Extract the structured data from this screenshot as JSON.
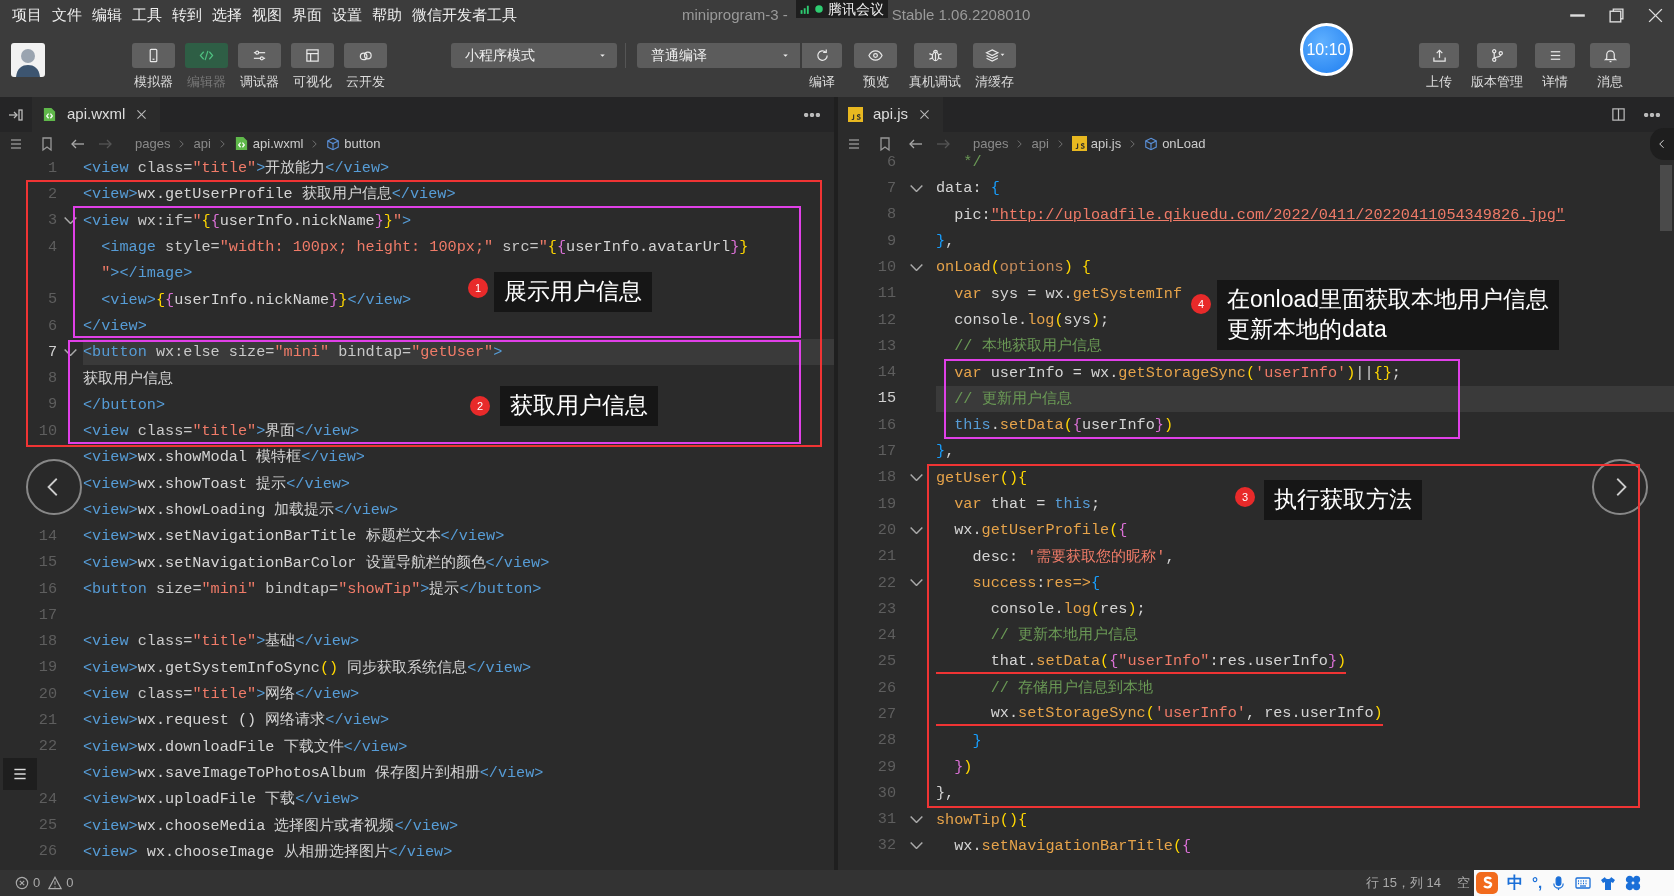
{
  "menu": [
    "项目",
    "文件",
    "编辑",
    "工具",
    "转到",
    "选择",
    "视图",
    "界面",
    "设置",
    "帮助",
    "微信开发者工具"
  ],
  "window_title": {
    "main": "miniprogram-3 -",
    "version": "Stable 1.06.2208010"
  },
  "meeting_badge": {
    "label": "腾讯会议"
  },
  "toolbar": {
    "view_buttons": [
      {
        "label": "模拟器",
        "selected": false
      },
      {
        "label": "编辑器",
        "selected": true
      },
      {
        "label": "调试器",
        "selected": false
      },
      {
        "label": "可视化",
        "selected": false
      },
      {
        "label": "云开发",
        "selected": false
      }
    ],
    "mode_select": {
      "value": "小程序模式"
    },
    "compile_select": {
      "value": "普通编译"
    },
    "actions": [
      {
        "label": "编译"
      },
      {
        "label": "预览"
      },
      {
        "label": "真机调试"
      },
      {
        "label": "清缓存"
      }
    ],
    "timer": "10:10",
    "right_buttons": [
      {
        "label": "上传"
      },
      {
        "label": "版本管理"
      },
      {
        "label": "详情"
      },
      {
        "label": "消息"
      }
    ]
  },
  "editors": [
    {
      "tab": "api.wxml",
      "kind": "wxml",
      "breadcrumb": [
        "pages",
        "api",
        "api.wxml",
        "button"
      ],
      "lines": [
        {
          "num": "1",
          "current": false,
          "fold": false,
          "underlined": false,
          "tokens": [
            {
              "kind": "tag",
              "text": "<view "
            },
            {
              "kind": "attr",
              "text": "class="
            },
            {
              "kind": "str",
              "text": "\"title\""
            },
            {
              "kind": "tag",
              "text": ">"
            },
            {
              "kind": "txt",
              "text": "开放能力"
            },
            {
              "kind": "tag",
              "text": "</view>"
            }
          ]
        },
        {
          "num": "2",
          "current": false,
          "fold": false,
          "underlined": false,
          "tokens": [
            {
              "kind": "tag",
              "text": "<view>"
            },
            {
              "kind": "txt",
              "text": "wx.getUserProfile 获取用户信息"
            },
            {
              "kind": "tag",
              "text": "</view>"
            }
          ]
        },
        {
          "num": "3",
          "current": false,
          "fold": true,
          "underlined": false,
          "tokens": [
            {
              "kind": "tag",
              "text": "<view "
            },
            {
              "kind": "attr",
              "text": "wx:if="
            },
            {
              "kind": "str",
              "text": "\""
            },
            {
              "kind": "br1",
              "text": "{"
            },
            {
              "kind": "br2",
              "text": "{"
            },
            {
              "kind": "txt",
              "text": "userInfo.nickName"
            },
            {
              "kind": "br2",
              "text": "}"
            },
            {
              "kind": "br1",
              "text": "}"
            },
            {
              "kind": "str",
              "text": "\""
            },
            {
              "kind": "tag",
              "text": ">"
            }
          ]
        },
        {
          "num": "4",
          "current": false,
          "fold": false,
          "underlined": false,
          "tokens": [
            {
              "kind": "tag",
              "text": "  <image "
            },
            {
              "kind": "attr",
              "text": "style="
            },
            {
              "kind": "str",
              "text": "\"width: 100px; height: 100px;\""
            },
            {
              "kind": "attr",
              "text": " src="
            },
            {
              "kind": "str",
              "text": "\""
            },
            {
              "kind": "br1",
              "text": "{"
            },
            {
              "kind": "br2",
              "text": "{"
            },
            {
              "kind": "txt",
              "text": "userInfo.avatarUrl"
            },
            {
              "kind": "br2",
              "text": "}"
            },
            {
              "kind": "br1",
              "text": "}"
            }
          ]
        },
        {
          "current": false,
          "fold": false,
          "underlined": false,
          "tokens": [
            {
              "kind": "str",
              "text": "  \""
            },
            {
              "kind": "tag",
              "text": "></image>"
            }
          ]
        },
        {
          "num": "5",
          "current": false,
          "fold": false,
          "underlined": false,
          "tokens": [
            {
              "kind": "tag",
              "text": "  <view>"
            },
            {
              "kind": "br1",
              "text": "{"
            },
            {
              "kind": "br2",
              "text": "{"
            },
            {
              "kind": "txt",
              "text": "userInfo.nickName"
            },
            {
              "kind": "br2",
              "text": "}"
            },
            {
              "kind": "br1",
              "text": "}"
            },
            {
              "kind": "tag",
              "text": "</view>"
            }
          ]
        },
        {
          "num": "6",
          "current": false,
          "fold": false,
          "underlined": false,
          "tokens": [
            {
              "kind": "tag",
              "text": "</view>"
            }
          ]
        },
        {
          "num": "7",
          "current": true,
          "fold": true,
          "underlined": false,
          "tokens": [
            {
              "kind": "tag",
              "text": "<button "
            },
            {
              "kind": "attr",
              "text": "wx:else size="
            },
            {
              "kind": "str",
              "text": "\"mini\""
            },
            {
              "kind": "attr",
              "text": " bindtap="
            },
            {
              "kind": "str",
              "text": "\"getUser\""
            },
            {
              "kind": "tag",
              "text": ">"
            }
          ]
        },
        {
          "num": "8",
          "current": false,
          "fold": false,
          "underlined": false,
          "tokens": [
            {
              "kind": "txt",
              "text": "获取用户信息"
            }
          ]
        },
        {
          "num": "9",
          "current": false,
          "fold": false,
          "underlined": false,
          "tokens": [
            {
              "kind": "tag",
              "text": "</button>"
            }
          ]
        },
        {
          "num": "10",
          "current": false,
          "fold": false,
          "underlined": false,
          "tokens": [
            {
              "kind": "tag",
              "text": "<view "
            },
            {
              "kind": "attr",
              "text": "class="
            },
            {
              "kind": "str",
              "text": "\"title\""
            },
            {
              "kind": "tag",
              "text": ">"
            },
            {
              "kind": "txt",
              "text": "界面"
            },
            {
              "kind": "tag",
              "text": "</view>"
            }
          ]
        },
        {
          "current": false,
          "fold": false,
          "underlined": false,
          "tokens": [
            {
              "kind": "tag",
              "text": "<view>"
            },
            {
              "kind": "txt",
              "text": "wx.showModal 模特框"
            },
            {
              "kind": "tag",
              "text": "</view>"
            }
          ]
        },
        {
          "current": false,
          "fold": false,
          "underlined": false,
          "tokens": [
            {
              "kind": "tag",
              "text": "<view>"
            },
            {
              "kind": "txt",
              "text": "wx.showToast 提示"
            },
            {
              "kind": "tag",
              "text": "</view>"
            }
          ]
        },
        {
          "current": false,
          "fold": false,
          "underlined": false,
          "tokens": [
            {
              "kind": "tag",
              "text": "<view>"
            },
            {
              "kind": "txt",
              "text": "wx.showLoading 加载提示"
            },
            {
              "kind": "tag",
              "text": "</view>"
            }
          ]
        },
        {
          "num": "14",
          "current": false,
          "fold": false,
          "underlined": false,
          "tokens": [
            {
              "kind": "tag",
              "text": "<view>"
            },
            {
              "kind": "txt",
              "text": "wx.setNavigationBarTitle 标题栏文本"
            },
            {
              "kind": "tag",
              "text": "</view>"
            }
          ]
        },
        {
          "num": "15",
          "current": false,
          "fold": false,
          "underlined": false,
          "tokens": [
            {
              "kind": "tag",
              "text": "<view>"
            },
            {
              "kind": "txt",
              "text": "wx.setNavigationBarColor 设置导航栏的颜色"
            },
            {
              "kind": "tag",
              "text": "</view>"
            }
          ]
        },
        {
          "num": "16",
          "current": false,
          "fold": false,
          "underlined": false,
          "tokens": [
            {
              "kind": "tag",
              "text": "<button "
            },
            {
              "kind": "attr",
              "text": "size="
            },
            {
              "kind": "str",
              "text": "\"mini\""
            },
            {
              "kind": "attr",
              "text": " bindtap="
            },
            {
              "kind": "str",
              "text": "\"showTip\""
            },
            {
              "kind": "tag",
              "text": ">"
            },
            {
              "kind": "txt",
              "text": "提示"
            },
            {
              "kind": "tag",
              "text": "</button>"
            }
          ]
        },
        {
          "num": "17",
          "current": false,
          "fold": false,
          "underlined": false
        },
        {
          "num": "18",
          "current": false,
          "fold": false,
          "underlined": false,
          "tokens": [
            {
              "kind": "tag",
              "text": "<view "
            },
            {
              "kind": "attr",
              "text": "class="
            },
            {
              "kind": "str",
              "text": "\"title\""
            },
            {
              "kind": "tag",
              "text": ">"
            },
            {
              "kind": "txt",
              "text": "基础"
            },
            {
              "kind": "tag",
              "text": "</view>"
            }
          ]
        },
        {
          "num": "19",
          "current": false,
          "fold": false,
          "underlined": false,
          "tokens": [
            {
              "kind": "tag",
              "text": "<view>"
            },
            {
              "kind": "txt",
              "text": "wx.getSystemInfoSync"
            },
            {
              "kind": "br1",
              "text": "()"
            },
            {
              "kind": "txt",
              "text": " 同步获取系统信息"
            },
            {
              "kind": "tag",
              "text": "</view>"
            }
          ]
        },
        {
          "num": "20",
          "current": false,
          "fold": false,
          "underlined": false,
          "tokens": [
            {
              "kind": "tag",
              "text": "<view "
            },
            {
              "kind": "attr",
              "text": "class="
            },
            {
              "kind": "str",
              "text": "\"title\""
            },
            {
              "kind": "tag",
              "text": ">"
            },
            {
              "kind": "txt",
              "text": "网络"
            },
            {
              "kind": "tag",
              "text": "</view>"
            }
          ]
        },
        {
          "num": "21",
          "current": false,
          "fold": false,
          "underlined": false,
          "tokens": [
            {
              "kind": "tag",
              "text": "<view>"
            },
            {
              "kind": "txt",
              "text": "wx.request () 网络请求"
            },
            {
              "kind": "tag",
              "text": "</view>"
            }
          ]
        },
        {
          "num": "22",
          "current": false,
          "fold": false,
          "underlined": false,
          "tokens": [
            {
              "kind": "tag",
              "text": "<view>"
            },
            {
              "kind": "txt",
              "text": "wx.downloadFile 下载文件"
            },
            {
              "kind": "tag",
              "text": "</view>"
            }
          ]
        },
        {
          "current": false,
          "fold": false,
          "underlined": false,
          "tokens": [
            {
              "kind": "tag",
              "text": "<view>"
            },
            {
              "kind": "txt",
              "text": "wx.saveImageToPhotosAlbum 保存图片到相册"
            },
            {
              "kind": "tag",
              "text": "</view>"
            }
          ]
        },
        {
          "num": "24",
          "current": false,
          "fold": false,
          "underlined": false,
          "tokens": [
            {
              "kind": "tag",
              "text": "<view>"
            },
            {
              "kind": "txt",
              "text": "wx.uploadFile 下载"
            },
            {
              "kind": "tag",
              "text": "</view>"
            }
          ]
        },
        {
          "num": "25",
          "current": false,
          "fold": false,
          "underlined": false,
          "tokens": [
            {
              "kind": "tag",
              "text": "<view>"
            },
            {
              "kind": "txt",
              "text": "wx.chooseMedia 选择图片或者视频"
            },
            {
              "kind": "tag",
              "text": "</view>"
            }
          ]
        },
        {
          "num": "26",
          "current": false,
          "fold": false,
          "underlined": false,
          "tokens": [
            {
              "kind": "tag",
              "text": "<view>"
            },
            {
              "kind": "txt",
              "text": " wx.chooseImage 从相册选择图片"
            },
            {
              "kind": "tag",
              "text": "</view>"
            }
          ]
        }
      ]
    },
    {
      "tab": "api.js",
      "kind": "js",
      "breadcrumb": [
        "pages",
        "api",
        "api.js",
        "onLoad"
      ],
      "lines": [
        {
          "num": "6",
          "current": false,
          "fold": false,
          "underlined": false,
          "tokens": [
            {
              "kind": "cmt",
              "text": "   */"
            }
          ]
        },
        {
          "num": "7",
          "current": false,
          "fold": true,
          "underlined": false,
          "tokens": [
            {
              "kind": "txt",
              "text": "data: "
            },
            {
              "kind": "br3",
              "text": "{"
            }
          ]
        },
        {
          "num": "8",
          "current": false,
          "fold": false,
          "underlined": false,
          "tokens": [
            {
              "kind": "txt",
              "text": "  pic:"
            },
            {
              "kind": "url",
              "text": "\"http://uploadfile.qikuedu.com/2022/0411/20220411054349826.jpg\""
            }
          ]
        },
        {
          "num": "9",
          "current": false,
          "fold": false,
          "underlined": false,
          "tokens": [
            {
              "kind": "br3",
              "text": "}"
            },
            {
              "kind": "txt",
              "text": ","
            }
          ]
        },
        {
          "num": "10",
          "current": false,
          "fold": true,
          "underlined": false,
          "tokens": [
            {
              "kind": "fn",
              "text": "onLoad"
            },
            {
              "kind": "br1",
              "text": "("
            },
            {
              "kind": "param",
              "text": "options"
            },
            {
              "kind": "br1",
              "text": ") {"
            }
          ]
        },
        {
          "num": "11",
          "current": false,
          "fold": false,
          "underlined": false,
          "tokens": [
            {
              "kind": "kw",
              "text": "  var"
            },
            {
              "kind": "txt",
              "text": " sys = wx."
            },
            {
              "kind": "fn",
              "text": "getSystemInf"
            }
          ]
        },
        {
          "num": "12",
          "current": false,
          "fold": false,
          "underlined": false,
          "tokens": [
            {
              "kind": "txt",
              "text": "  console."
            },
            {
              "kind": "fn",
              "text": "log"
            },
            {
              "kind": "br1",
              "text": "("
            },
            {
              "kind": "txt",
              "text": "sys"
            },
            {
              "kind": "br1",
              "text": ")"
            },
            {
              "kind": "txt",
              "text": ";"
            }
          ]
        },
        {
          "num": "13",
          "current": false,
          "fold": false,
          "underlined": false,
          "tokens": [
            {
              "kind": "cmt",
              "text": "  // 本地获取用户信息"
            }
          ]
        },
        {
          "num": "14",
          "current": false,
          "fold": false,
          "underlined": false,
          "tokens": [
            {
              "kind": "kw",
              "text": "  var"
            },
            {
              "kind": "txt",
              "text": " userInfo = wx."
            },
            {
              "kind": "fn",
              "text": "getStorageSync"
            },
            {
              "kind": "br1",
              "text": "("
            },
            {
              "kind": "str",
              "text": "'userInfo'"
            },
            {
              "kind": "br1",
              "text": ")"
            },
            {
              "kind": "txt",
              "text": "||"
            },
            {
              "kind": "br1",
              "text": "{}"
            },
            {
              "kind": "txt",
              "text": ";"
            }
          ]
        },
        {
          "num": "15",
          "current": true,
          "fold": false,
          "underlined": false,
          "tokens": [
            {
              "kind": "cmt",
              "text": "  // 更新用户信息"
            }
          ]
        },
        {
          "num": "16",
          "current": false,
          "fold": false,
          "underlined": false,
          "tokens": [
            {
              "kind": "this",
              "text": "  this"
            },
            {
              "kind": "txt",
              "text": "."
            },
            {
              "kind": "fn",
              "text": "setData"
            },
            {
              "kind": "br1",
              "text": "("
            },
            {
              "kind": "br2",
              "text": "{"
            },
            {
              "kind": "txt",
              "text": "userInfo"
            },
            {
              "kind": "br2",
              "text": "}"
            },
            {
              "kind": "br1",
              "text": ")"
            }
          ]
        },
        {
          "num": "17",
          "current": false,
          "fold": false,
          "underlined": false,
          "tokens": [
            {
              "kind": "br3",
              "text": "}"
            },
            {
              "kind": "txt",
              "text": ","
            }
          ]
        },
        {
          "num": "18",
          "current": false,
          "fold": true,
          "underlined": false,
          "tokens": [
            {
              "kind": "fn",
              "text": "getUser"
            },
            {
              "kind": "br1",
              "text": "(){"
            }
          ]
        },
        {
          "num": "19",
          "current": false,
          "fold": false,
          "underlined": false,
          "tokens": [
            {
              "kind": "kw",
              "text": "  var"
            },
            {
              "kind": "txt",
              "text": " that = "
            },
            {
              "kind": "this",
              "text": "this"
            },
            {
              "kind": "txt",
              "text": ";"
            }
          ]
        },
        {
          "num": "20",
          "current": false,
          "fold": true,
          "underlined": false,
          "tokens": [
            {
              "kind": "txt",
              "text": "  wx."
            },
            {
              "kind": "fn",
              "text": "getUserProfile"
            },
            {
              "kind": "br1",
              "text": "("
            },
            {
              "kind": "br2",
              "text": "{"
            }
          ]
        },
        {
          "num": "21",
          "current": false,
          "fold": false,
          "underlined": false,
          "tokens": [
            {
              "kind": "txt",
              "text": "    desc: "
            },
            {
              "kind": "str",
              "text": "'需要获取您的昵称'"
            },
            {
              "kind": "txt",
              "text": ","
            }
          ]
        },
        {
          "num": "22",
          "current": false,
          "fold": true,
          "underlined": false,
          "tokens": [
            {
              "kind": "fn",
              "text": "    success"
            },
            {
              "kind": "txt",
              "text": ":"
            },
            {
              "kind": "fn",
              "text": "res=>"
            },
            {
              "kind": "br3",
              "text": "{"
            }
          ]
        },
        {
          "num": "23",
          "current": false,
          "fold": false,
          "underlined": false,
          "tokens": [
            {
              "kind": "txt",
              "text": "      console."
            },
            {
              "kind": "fn",
              "text": "log"
            },
            {
              "kind": "br1",
              "text": "("
            },
            {
              "kind": "txt",
              "text": "res"
            },
            {
              "kind": "br1",
              "text": ")"
            },
            {
              "kind": "txt",
              "text": ";"
            }
          ]
        },
        {
          "num": "24",
          "current": false,
          "fold": false,
          "underlined": false,
          "tokens": [
            {
              "kind": "cmt",
              "text": "      // 更新本地用户信息"
            }
          ]
        },
        {
          "num": "25",
          "current": false,
          "fold": false,
          "underlined": true,
          "tokens": [
            {
              "kind": "txt",
              "text": "      that."
            },
            {
              "kind": "fn",
              "text": "setData"
            },
            {
              "kind": "br1",
              "text": "("
            },
            {
              "kind": "br2",
              "text": "{"
            },
            {
              "kind": "str",
              "text": "\"userInfo\""
            },
            {
              "kind": "txt",
              "text": ":res.userInfo"
            },
            {
              "kind": "br2",
              "text": "}"
            },
            {
              "kind": "br1",
              "text": ")"
            }
          ]
        },
        {
          "num": "26",
          "current": false,
          "fold": false,
          "underlined": false,
          "tokens": [
            {
              "kind": "cmt",
              "text": "      // 存储用户信息到本地"
            }
          ]
        },
        {
          "num": "27",
          "current": false,
          "fold": false,
          "underlined": true,
          "tokens": [
            {
              "kind": "txt",
              "text": "      wx."
            },
            {
              "kind": "fn",
              "text": "setStorageSync"
            },
            {
              "kind": "br1",
              "text": "("
            },
            {
              "kind": "str",
              "text": "'userInfo'"
            },
            {
              "kind": "txt",
              "text": ", res.userInfo"
            },
            {
              "kind": "br1",
              "text": ")"
            }
          ]
        },
        {
          "num": "28",
          "current": false,
          "fold": false,
          "underlined": false,
          "tokens": [
            {
              "kind": "br3",
              "text": "    }"
            }
          ]
        },
        {
          "num": "29",
          "current": false,
          "fold": false,
          "underlined": false,
          "tokens": [
            {
              "kind": "br2",
              "text": "  }"
            },
            {
              "kind": "br1",
              "text": ")"
            }
          ]
        },
        {
          "num": "30",
          "current": false,
          "fold": false,
          "underlined": false,
          "tokens": [
            {
              "kind": "txt",
              "text": "},"
            }
          ]
        },
        {
          "num": "31",
          "current": false,
          "fold": true,
          "underlined": false,
          "tokens": [
            {
              "kind": "fn",
              "text": "showTip"
            },
            {
              "kind": "br1",
              "text": "(){"
            }
          ]
        },
        {
          "num": "32",
          "current": false,
          "fold": true,
          "underlined": false,
          "tokens": [
            {
              "kind": "txt",
              "text": "  wx."
            },
            {
              "kind": "fn",
              "text": "setNavigationBarTitle"
            },
            {
              "kind": "br1",
              "text": "("
            },
            {
              "kind": "br2",
              "text": "{"
            }
          ]
        }
      ]
    }
  ],
  "annotations": {
    "boxes": [
      {
        "color": "#f03434"
      },
      {
        "color": "#e040e8"
      },
      {
        "color": "#e040e8"
      },
      {
        "color": "#e040e8"
      },
      {
        "color": "#f03434"
      }
    ],
    "callouts": [
      {
        "number": "1",
        "lines": [
          "展示用户信息"
        ]
      },
      {
        "number": "2",
        "lines": [
          "获取用户信息"
        ]
      },
      {
        "number": "4",
        "lines": [
          "在onload里面获取本地用户信息",
          "更新本地的data"
        ]
      },
      {
        "number": "3",
        "lines": [
          "执行获取方法"
        ]
      }
    ]
  },
  "status_bar": {
    "errors": "0",
    "warnings": "0",
    "cursor": "行 15，列 14",
    "mode": "空"
  },
  "ime_bar": {
    "language": "中",
    "punctuation": "°,"
  }
}
